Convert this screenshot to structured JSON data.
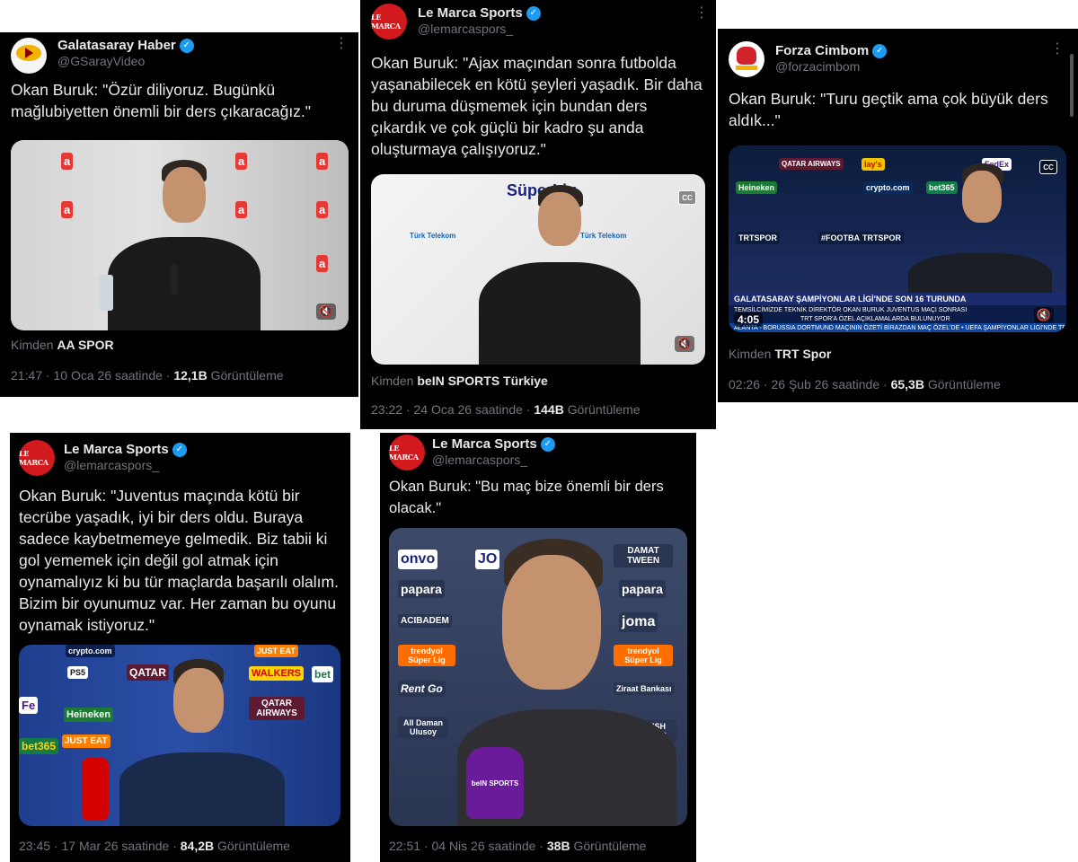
{
  "tweets": [
    {
      "account_name": "Galatasaray Haber",
      "handle": "@GSarayVideo",
      "text": "Okan Buruk: \"Özür diliyoruz. Bugünkü mağlubiyetten önemli bir ders çıkaracağız.\"",
      "source_prefix": "Kimden",
      "source": "AA SPOR",
      "time": "21:47 · 10 Oca 26 saatinde ·",
      "views": "12,1B",
      "views_label": "Görüntüleme",
      "avatar_icon": "galatasaray-haber-logo",
      "media_badges": [
        "aa"
      ]
    },
    {
      "account_name": "Le Marca Sports",
      "handle": "@lemarcaspors_",
      "text": "Okan Buruk: \"Ajax maçından sonra futbolda yaşanabilecek en kötü şeyleri yaşadık. Bir daha bu duruma düşmemek için bundan ders çıkardık ve çok güçlü bir kadro şu anda oluşturmaya çalışıyoruz.\"",
      "source_prefix": "Kimden",
      "source": "beIN SPORTS Türkiye",
      "time": "23:22 · 24 Oca 26 saatinde ·",
      "views": "144B",
      "views_label": "Görüntüleme",
      "avatar_text": "LE MARCA",
      "media_badges": [
        "SüperLig",
        "Türk Telekom",
        "CC"
      ]
    },
    {
      "account_name": "Forza Cimbom",
      "handle": "@forzacimbom",
      "text": "Okan Buruk: \"Turu geçtik ama çok büyük ders aldık...\"",
      "source_prefix": "Kimden",
      "source": "TRT Spor",
      "time": "02:26 · 26 Şub 26 saatinde ·",
      "views": "65,3B",
      "views_label": "Görüntüleme",
      "avatar_icon": "forza-cimbom-logo",
      "duration": "4:05",
      "ticker_title": "GALATASARAY ŞAMPİYONLAR LİGİ'NDE SON 16 TURUNDA",
      "ticker_sub": "TEMSİLCİMİZDE TEKNİK DİREKTÖR OKAN BURUK JUVENTUS MAÇI SONRASI",
      "ticker_sub2": "TRT SPOR'A ÖZEL AÇIKLAMALARDA BULUNUYOR",
      "ticker_bottom": "ALANTA - BORUSSIA DORTMUND MAÇININ ÖZETİ BİRAZDAN MAÇ ÖZEL'DE • UEFA ŞAMPİYONLAR LİGİ'NDE TEMSİLCİMİZ GALATASARAY'IN DA YE",
      "media_badges": [
        "QATAR AIRWAYS",
        "FedEx",
        "Heineken",
        "bet365",
        "lay's",
        "crypto.com",
        "TRTSPOR",
        "#FOOTBALL",
        "CC"
      ]
    },
    {
      "account_name": "Le Marca Sports",
      "handle": "@lemarcaspors_",
      "text": "Okan Buruk: \"Juventus maçında kötü bir tecrübe yaşadık, iyi bir ders oldu. Buraya sadece kaybetmemeye gelmedik. Biz tabii ki gol yememek için değil gol atmak için oynamalıyız ki bu tür maçlarda başarılı olalım. Bizim bir oyunumuz var. Her zaman bu oyunu oynamak istiyoruz.\"",
      "time": "23:45 · 17 Mar 26 saatinde ·",
      "views": "84,2B",
      "views_label": "Görüntüleme",
      "avatar_text": "LE MARCA",
      "media_badges": [
        "crypto.com",
        "JUST EAT",
        "PS5",
        "QATAR",
        "WALKERS",
        "bet",
        "Heineken",
        "QATAR AIRWAYS",
        "bet365",
        "JUST EAT",
        "Fe"
      ]
    },
    {
      "account_name": "Le Marca Sports",
      "handle": "@lemarcaspors_",
      "text": "Okan Buruk: \"Bu maç bize önemli bir ders olacak.\"",
      "time": "22:51 · 04 Nis 26 saatinde ·",
      "views": "38B",
      "views_label": "Görüntüleme",
      "avatar_text": "LE MARCA",
      "media_badges": [
        "onvo",
        "JO",
        "DAMAT TWEEN",
        "papara",
        "papara",
        "ACIBADEM",
        "joma",
        "trendyol Süper Lig",
        "trendyol Süper Lig",
        "Rent Go",
        "Ziraat Bankası",
        "All Daman Ulusoy",
        "TURKISH AIRLINES",
        "beIN SPORTS"
      ]
    }
  ],
  "colors": {
    "background": "#000000",
    "text_primary": "#e7e9ea",
    "text_secondary": "#71767b",
    "verified": "#1d9bf0"
  }
}
